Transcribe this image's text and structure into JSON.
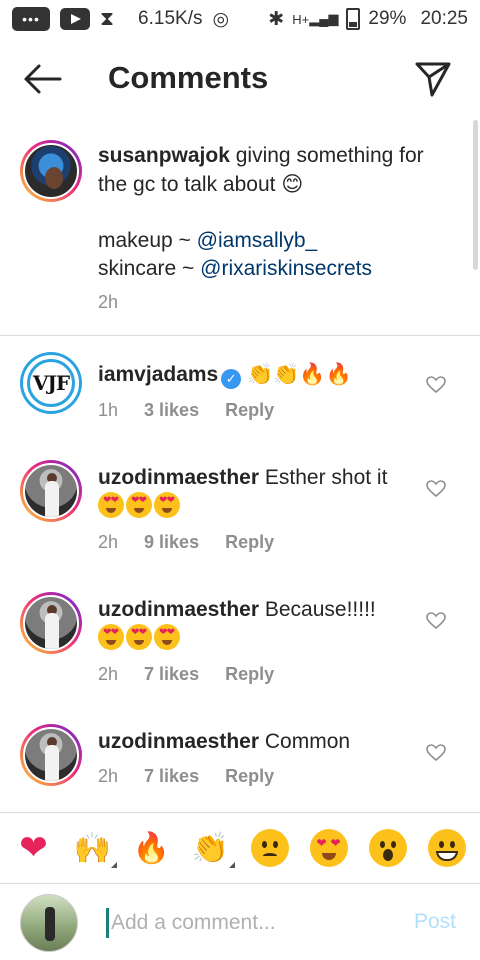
{
  "status_bar": {
    "speed": "6.15K/s",
    "network": "H+",
    "battery": "29%",
    "time": "20:25"
  },
  "header": {
    "title": "Comments"
  },
  "caption": {
    "username": "susanpwajok",
    "text": "giving something for the gc to talk about",
    "emoji": "😊",
    "makeup_label": "makeup ~",
    "makeup_mention": "@iamsallyb_",
    "skincare_label": "skincare ~",
    "skincare_mention": "@rixariskinsecrets",
    "time": "2h"
  },
  "comments": [
    {
      "username": "iamvjadams",
      "verified": true,
      "avatar_text": "VJF",
      "text": "👏👏🔥🔥",
      "time": "1h",
      "likes": "3 likes",
      "reply": "Reply"
    },
    {
      "username": "uzodinmaesther",
      "text": "Esther shot it",
      "emoji_count": 3,
      "time": "2h",
      "likes": "9 likes",
      "reply": "Reply"
    },
    {
      "username": "uzodinmaesther",
      "text": "Because!!!!!",
      "emoji_count": 3,
      "time": "2h",
      "likes": "7 likes",
      "reply": "Reply"
    },
    {
      "username": "uzodinmaesther",
      "text": "Common",
      "time": "2h",
      "likes": "7 likes",
      "reply": "Reply"
    }
  ],
  "emoji_bar": [
    "heart",
    "raising-hands",
    "fire",
    "clapping-hands",
    "sad-face",
    "heart-eyes",
    "surprised-face",
    "grinning-face"
  ],
  "emoji_glyphs": {
    "heart": "❤",
    "raising_hands": "🙌",
    "fire": "🔥",
    "clap": "👏"
  },
  "composer": {
    "placeholder": "Add a comment...",
    "post_label": "Post"
  },
  "colors": {
    "link": "#00376b",
    "muted": "#8e8e8e",
    "post_disabled": "#b2dffc",
    "verified": "#3897f0",
    "heart": "#e4245b"
  }
}
